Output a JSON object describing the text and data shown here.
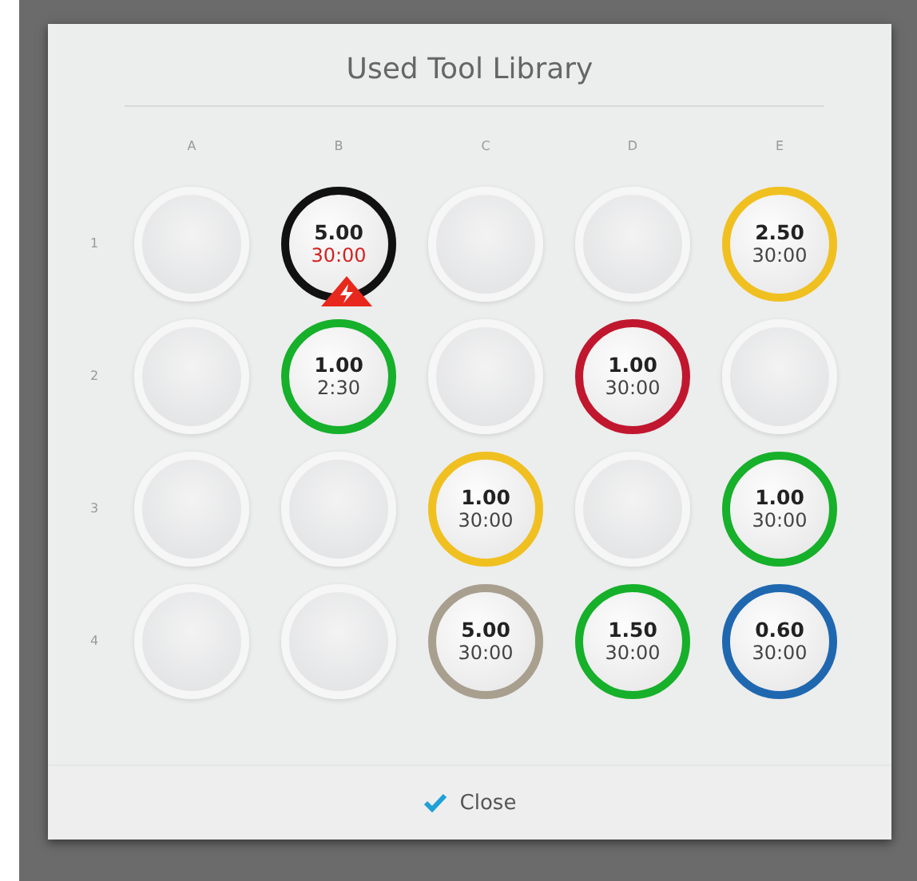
{
  "dialog": {
    "title": "Used Tool Library"
  },
  "columns": [
    "A",
    "B",
    "C",
    "D",
    "E"
  ],
  "rows": [
    {
      "label": "1",
      "slots": [
        {
          "kind": "empty"
        },
        {
          "kind": "tool",
          "value": "5.00",
          "time": "30:00",
          "color": "#111111",
          "warning": true
        },
        {
          "kind": "empty"
        },
        {
          "kind": "empty"
        },
        {
          "kind": "tool",
          "value": "2.50",
          "time": "30:00",
          "color": "#f0c020",
          "warning": false
        }
      ]
    },
    {
      "label": "2",
      "slots": [
        {
          "kind": "empty"
        },
        {
          "kind": "tool",
          "value": "1.00",
          "time": "2:30",
          "color": "#16b02a",
          "warning": false
        },
        {
          "kind": "empty"
        },
        {
          "kind": "tool",
          "value": "1.00",
          "time": "30:00",
          "color": "#c0172e",
          "warning": false
        },
        {
          "kind": "empty"
        }
      ]
    },
    {
      "label": "3",
      "slots": [
        {
          "kind": "empty"
        },
        {
          "kind": "empty"
        },
        {
          "kind": "tool",
          "value": "1.00",
          "time": "30:00",
          "color": "#f0c020",
          "warning": false
        },
        {
          "kind": "empty"
        },
        {
          "kind": "tool",
          "value": "1.00",
          "time": "30:00",
          "color": "#16b02a",
          "warning": false
        }
      ]
    },
    {
      "label": "4",
      "slots": [
        {
          "kind": "empty"
        },
        {
          "kind": "empty"
        },
        {
          "kind": "tool",
          "value": "5.00",
          "time": "30:00",
          "color": "#a89f8f",
          "warning": false
        },
        {
          "kind": "tool",
          "value": "1.50",
          "time": "30:00",
          "color": "#16b02a",
          "warning": false
        },
        {
          "kind": "tool",
          "value": "0.60",
          "time": "30:00",
          "color": "#1f68b0",
          "warning": false
        }
      ]
    }
  ],
  "footer": {
    "button": "Close"
  }
}
